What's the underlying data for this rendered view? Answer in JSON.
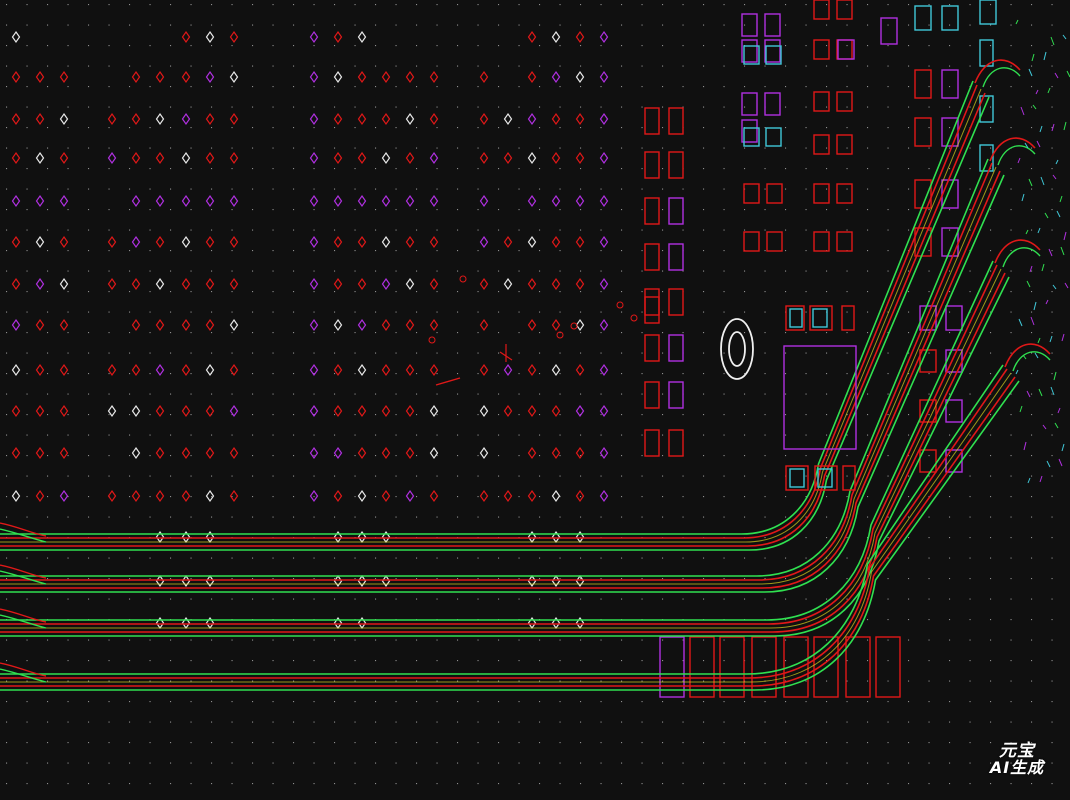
{
  "board_view": {
    "background_color": "#101010",
    "grid_dot_color": "#b9b9b9",
    "colors": {
      "pad_red": "#e01818",
      "pad_white": "#e8e8e8",
      "pad_magenta": "#b030e0",
      "cyan": "#40c8d8",
      "green": "#30e050",
      "yellow": "#d8d020",
      "outline_white": "#f0f0f0"
    }
  },
  "watermark": {
    "line1": "元宝",
    "line2": "AI生成"
  }
}
